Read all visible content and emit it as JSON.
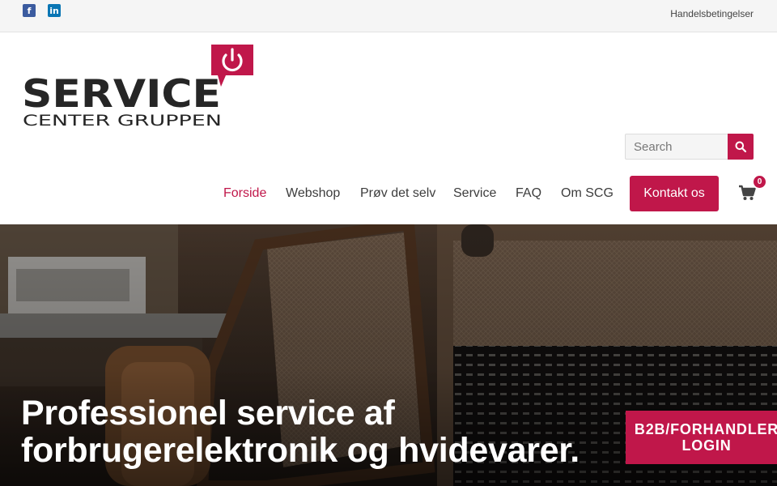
{
  "topbar": {
    "terms_label": "Handelsbetingelser"
  },
  "logo": {
    "line1": "SERVICE",
    "line2": "CENTER GRUPPEN",
    "accent": "#c0174a"
  },
  "search": {
    "placeholder": "Search"
  },
  "nav": {
    "items": [
      "Forside",
      "Webshop",
      "Prøv det selv",
      "Service",
      "FAQ",
      "Om SCG"
    ],
    "active": "Forside",
    "contact_label": "Kontakt os",
    "cart_count": "0"
  },
  "hero": {
    "title_line1": "Professionel service af",
    "title_line2": "forbrugerelektronik og hvidevarer.",
    "b2b_line1": "B2B/FORHANDLER",
    "b2b_line2": "LOGIN"
  },
  "colors": {
    "brand": "#c0174a",
    "facebook": "#3b5b9f",
    "linkedin": "#0a76b4"
  },
  "icons": [
    "facebook-icon",
    "linkedin-icon",
    "power-icon",
    "search-icon",
    "cart-icon"
  ]
}
